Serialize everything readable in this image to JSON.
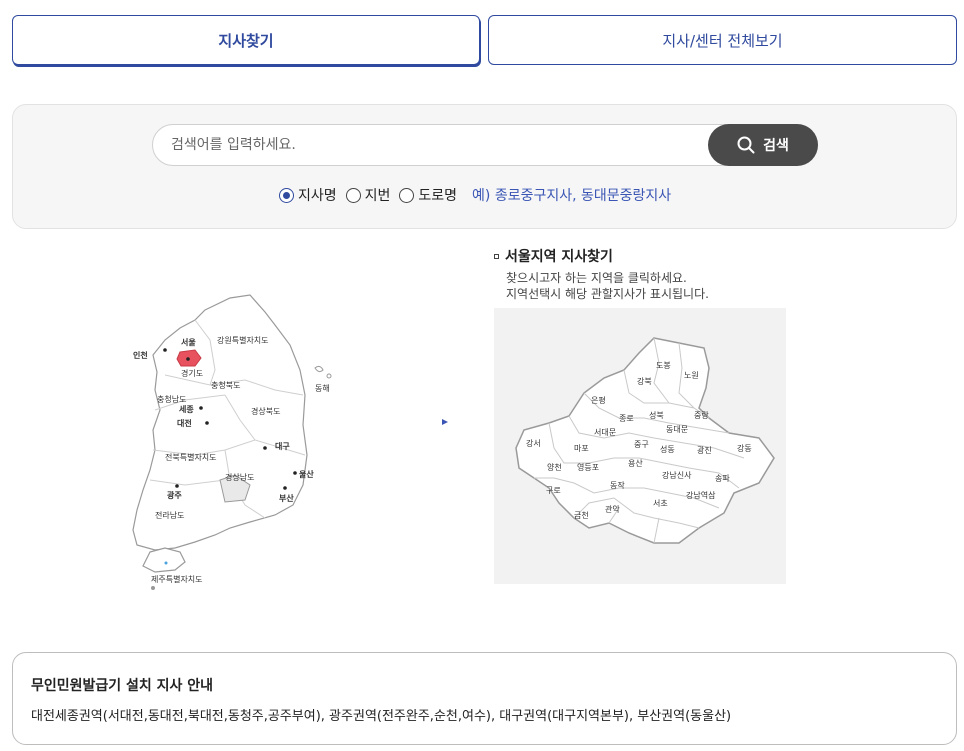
{
  "tabs": [
    {
      "label": "지사찾기",
      "active": true
    },
    {
      "label": "지사/센터 전체보기",
      "active": false
    }
  ],
  "search": {
    "placeholder": "검색어를 입력하세요.",
    "button_label": "검색",
    "options": [
      {
        "label": "지사명",
        "checked": true
      },
      {
        "label": "지번",
        "checked": false
      },
      {
        "label": "도로명",
        "checked": false
      }
    ],
    "example": "예) 종로중구지사, 동대문중랑지사"
  },
  "korea_map": {
    "provinces": [
      "서울",
      "인천",
      "경기도",
      "강원특별자치도",
      "충청북도",
      "충청남도",
      "세종",
      "대전",
      "경상북도",
      "대구",
      "전북특별자치도",
      "경상남도",
      "울산",
      "부산",
      "광주",
      "전라남도",
      "제주특별자치도",
      "동해"
    ],
    "selected": "서울"
  },
  "region": {
    "title": "서울지역 지사찾기",
    "desc1": "찾으시고자 하는 지역을 클릭하세요.",
    "desc2": "지역선택시 해당 관할지사가 표시됩니다."
  },
  "seoul_map": {
    "districts": [
      "도봉",
      "노원",
      "강북",
      "은평",
      "성북",
      "중랑",
      "종로",
      "동대문",
      "서대문",
      "강서",
      "마포",
      "중구",
      "성동",
      "광진",
      "강동",
      "양천",
      "영등포",
      "용산",
      "강남신사",
      "송파",
      "구로",
      "동작",
      "서초",
      "강남역삼",
      "금천",
      "관악"
    ]
  },
  "notice": {
    "title": "무인민원발급기 설치 지사 안내",
    "body": "대전세종권역(서대전,동대전,북대전,동청주,공주부여), 광주권역(전주완주,순천,여수), 대구권역(대구지역본부), 부산권역(동울산)"
  },
  "colors": {
    "accent": "#2f4a9e",
    "selected_region": "#e8525e",
    "search_button": "#4a4a4a"
  }
}
